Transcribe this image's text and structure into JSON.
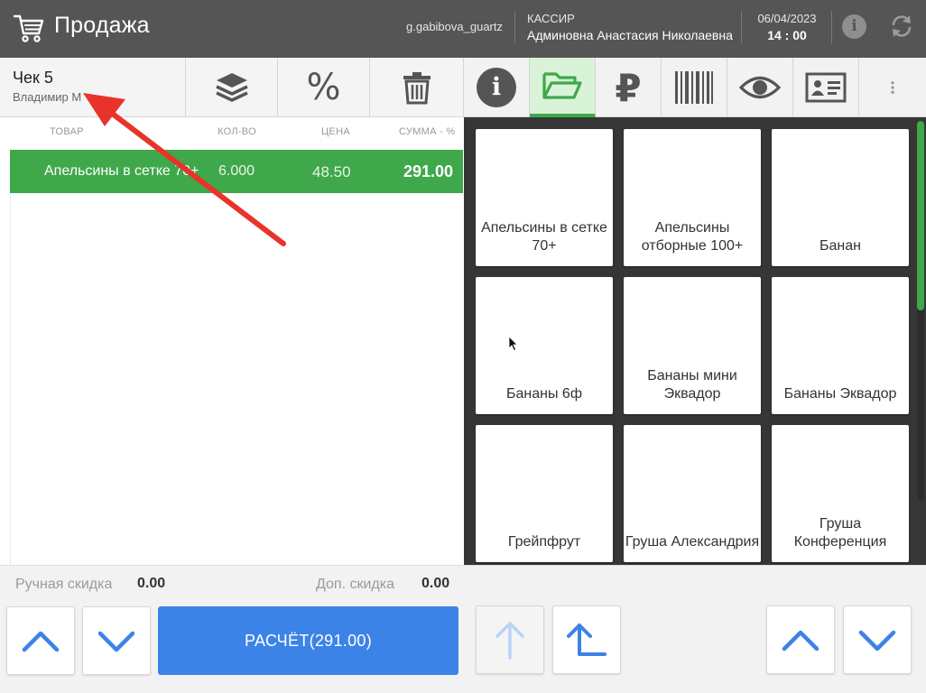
{
  "header": {
    "title": "Продажа",
    "login": "g.gabibova_guartz",
    "role": "КАССИР",
    "user_name": "Админовна Анастасия Николаевна",
    "date": "06/04/2023",
    "time": "14 : 00",
    "info_glyph": "i"
  },
  "check": {
    "title": "Чек 5",
    "customer": "Владимир М"
  },
  "toolbar": {
    "discount_glyph": "%"
  },
  "columns": {
    "product": "ТОВАР",
    "qty": "КОЛ-ВО",
    "price": "ЦЕНА",
    "sum": "СУММА - %"
  },
  "items": [
    {
      "name": "Апельсины в сетке 70+",
      "qty": "6.000",
      "price": "48.50",
      "sum": "291.00"
    }
  ],
  "totals": {
    "manual_discount_label": "Ручная скидка",
    "manual_discount_value": "0.00",
    "extra_discount_label": "Доп. скидка",
    "extra_discount_value": "0.00"
  },
  "pay_button": "РАСЧЁТ(291.00)",
  "tabs": {
    "info_glyph": "i",
    "ruble_glyph": "₽"
  },
  "products": [
    {
      "name": "Апельсины в сетке 70+"
    },
    {
      "name": "Апельсины отборные 100+"
    },
    {
      "name": "Банан"
    },
    {
      "name": "Бананы 6ф"
    },
    {
      "name": "Бананы мини Эквадор"
    },
    {
      "name": "Бананы Эквадор"
    },
    {
      "name": "Грейпфрут"
    },
    {
      "name": "Груша Александрия"
    },
    {
      "name": "Груша Конференция"
    }
  ],
  "colors": {
    "header_bg": "#555555",
    "selected_row": "#3fa84a",
    "pay_button": "#3c83e8",
    "arrow_blue": "#3c83e8",
    "annotation_arrow": "#e8332a"
  }
}
